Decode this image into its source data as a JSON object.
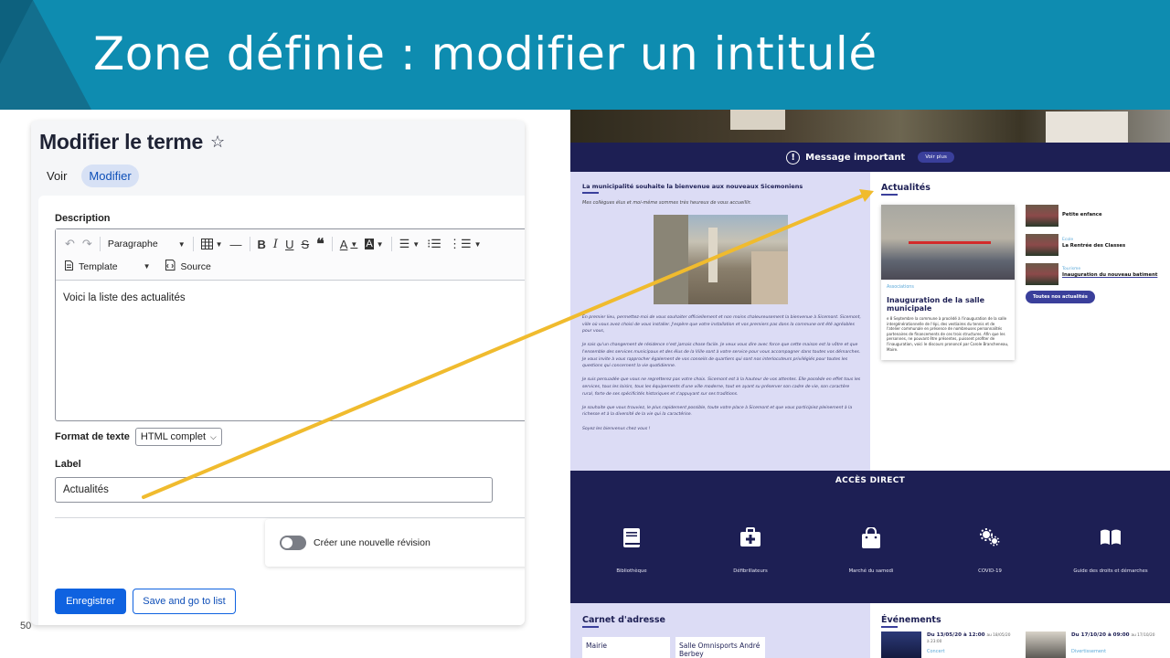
{
  "slide": {
    "title": "Zone définie : modifier un intitulé",
    "page_number": "50",
    "header_color": "#0e8cb0",
    "accent_color": "#f0bb2e"
  },
  "form": {
    "page_title": "Modifier le terme",
    "tabs": [
      {
        "label": "Voir",
        "active": false
      },
      {
        "label": "Modifier",
        "active": true
      }
    ],
    "description_label": "Description",
    "toolbar": {
      "paragraph_label": "Paragraphe",
      "template_label": "Template",
      "source_label": "Source"
    },
    "editor_content": "Voici la liste des actualités",
    "text_format_label": "Format de texte",
    "text_format_value": "HTML complet",
    "label_field_label": "Label",
    "label_field_value": "Actualités",
    "revision_label": "Créer une nouvelle révision",
    "save_label": "Enregistrer",
    "save_list_label": "Save and go to list",
    "primary_color": "#0f62e0"
  },
  "site": {
    "alert": {
      "text": "Message important",
      "button": "Voir plus"
    },
    "welcome": {
      "title": "La municipalité souhaite la bienvenue aux nouveaux Sicemoniens",
      "intro": "Mes collègues élus et moi-même sommes très heureux de vous accueillir.",
      "paragraphs": [
        "En premier lieu, permettez-moi de vous souhaiter officiellement et non moins chaleureusement la bienvenue à Sicemont. Sicemont, ville où vous avez choisi de vous installer. J'espère que votre installation et vos premiers pas dans la commune ont été agréables pour vous,",
        "Je sais qu'un changement de résidence n'est jamais chose facile. Je veux vous dire avec force que cette maison est la vôtre et que l'ensemble des services municipaux et des élus de la Ville sont à votre service pour vous accompagner dans toutes vos démarches. Je vous invite à vous rapprocher également de vos conseils de quartiers qui sont nos interlocuteurs privilégiés pour toutes les questions qui concernent la vie quotidienne.",
        "Je suis persuadée que vous ne regretterez pas votre choix. Sicemont est à la hauteur de vos attentes. Elle possède en effet tous les services, tous les loisirs, tous les équipements d'une ville moderne, tout en ayant su préserver son cadre de vie, son caractère rural, forte de ses spécificités historiques et s'appuyant sur ses traditions.",
        "Je souhaite que vous trouviez, le plus rapidement possible, toute votre place à Sicemont et que vous participiez pleinement à la richesse et à la diversité de la vie qui la caractérise.",
        "Soyez les bienvenus chez vous !"
      ]
    },
    "news": {
      "title": "Actualités",
      "featured": {
        "category": "Associations",
        "title": "Inauguration de la salle municipale",
        "text": "e 8 Septembre la commune à procédé à l'inauguration de la salle intergénérationnelle de l'épi, des vestiaires du tennis et de l'atelier communale en présence de nombreuses personnalités partenaires de financements de ces trois structures. Afin que les personnes, ne pouvant être présentes, puissent profiter de l'inauguration, voici le discours prononcé par Carole Brancheneau, Maire."
      },
      "items": [
        {
          "category": "",
          "title": "Petite enfance"
        },
        {
          "category": "Ecole",
          "title": "La Rentrée des Classes"
        },
        {
          "category": "Tourisme",
          "title": "Inauguration du nouveau batiment"
        }
      ],
      "all_button": "Toutes nos actualités"
    },
    "direct_access": {
      "title": "ACCÈS DIRECT",
      "items": [
        {
          "icon": "book-icon",
          "label": "Bibliothèque"
        },
        {
          "icon": "first-aid-kit-icon",
          "label": "Défibrillateurs"
        },
        {
          "icon": "shopping-bag-icon",
          "label": "Marché du samedi"
        },
        {
          "icon": "virus-icon",
          "label": "COVID-19"
        },
        {
          "icon": "open-book-icon",
          "label": "Guide des droits et démarches"
        }
      ]
    },
    "address": {
      "title": "Carnet d'adresse",
      "cards": [
        "Mairie",
        "Salle Omnisports André Berbey"
      ]
    },
    "events": {
      "title": "Événements",
      "items": [
        {
          "date": "Du 13/05/20 à 12:00",
          "until": "au 18/05/20",
          "time": "à 23:00",
          "category": "Concert"
        },
        {
          "date": "Du 17/10/20 à 09:00",
          "until": "au 17/10/20",
          "time": "",
          "category": "Divertissement"
        }
      ]
    }
  }
}
